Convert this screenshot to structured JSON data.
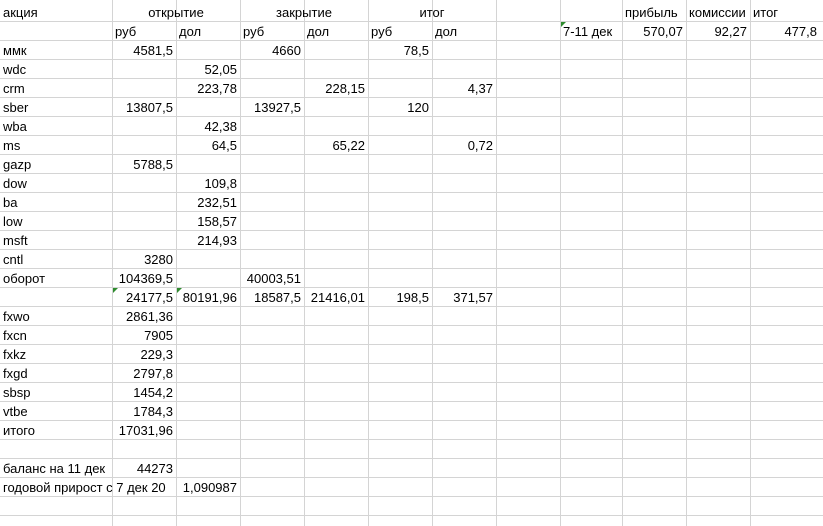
{
  "header": {
    "col_a": "акция",
    "open": "открытие",
    "close": "закрытие",
    "result": "итог",
    "profit": "прибыль",
    "fees": "комиссии",
    "total": "итог"
  },
  "subheader": {
    "open_rub": "руб",
    "open_usd": "дол",
    "close_rub": "руб",
    "close_usd": "дол",
    "result_rub": "руб",
    "result_usd": "дол",
    "period": "7-11 дек",
    "profit_value": "570,07",
    "fees_value": "92,27",
    "total_value": "477,8"
  },
  "rows": [
    {
      "name": "ммк",
      "open_rub": "4581,5",
      "open_usd": "",
      "close_rub": "4660",
      "close_usd": "",
      "res_rub": "78,5",
      "res_usd": ""
    },
    {
      "name": "wdc",
      "open_rub": "",
      "open_usd": "52,05",
      "close_rub": "",
      "close_usd": "",
      "res_rub": "",
      "res_usd": ""
    },
    {
      "name": "crm",
      "open_rub": "",
      "open_usd": "223,78",
      "close_rub": "",
      "close_usd": "228,15",
      "res_rub": "",
      "res_usd": "4,37"
    },
    {
      "name": "sber",
      "open_rub": "13807,5",
      "open_usd": "",
      "close_rub": "13927,5",
      "close_usd": "",
      "res_rub": "120",
      "res_usd": ""
    },
    {
      "name": "wba",
      "open_rub": "",
      "open_usd": "42,38",
      "close_rub": "",
      "close_usd": "",
      "res_rub": "",
      "res_usd": ""
    },
    {
      "name": "ms",
      "open_rub": "",
      "open_usd": "64,5",
      "close_rub": "",
      "close_usd": "65,22",
      "res_rub": "",
      "res_usd": "0,72"
    },
    {
      "name": "gazp",
      "open_rub": "5788,5",
      "open_usd": "",
      "close_rub": "",
      "close_usd": "",
      "res_rub": "",
      "res_usd": ""
    },
    {
      "name": "dow",
      "open_rub": "",
      "open_usd": "109,8",
      "close_rub": "",
      "close_usd": "",
      "res_rub": "",
      "res_usd": ""
    },
    {
      "name": "ba",
      "open_rub": "",
      "open_usd": "232,51",
      "close_rub": "",
      "close_usd": "",
      "res_rub": "",
      "res_usd": ""
    },
    {
      "name": "low",
      "open_rub": "",
      "open_usd": "158,57",
      "close_rub": "",
      "close_usd": "",
      "res_rub": "",
      "res_usd": ""
    },
    {
      "name": "msft",
      "open_rub": "",
      "open_usd": "214,93",
      "close_rub": "",
      "close_usd": "",
      "res_rub": "",
      "res_usd": ""
    },
    {
      "name": "cntl",
      "open_rub": "3280",
      "open_usd": "",
      "close_rub": "",
      "close_usd": "",
      "res_rub": "",
      "res_usd": ""
    },
    {
      "name": "оборот",
      "open_rub": "104369,5",
      "open_usd": "",
      "close_rub": "40003,51",
      "close_usd": "",
      "res_rub": "",
      "res_usd": ""
    },
    {
      "name": "",
      "open_rub": "24177,5",
      "open_usd": "80191,96",
      "close_rub": "18587,5",
      "close_usd": "21416,01",
      "res_rub": "198,5",
      "res_usd": "371,57"
    },
    {
      "name": "fxwo",
      "open_rub": "2861,36",
      "open_usd": "",
      "close_rub": "",
      "close_usd": "",
      "res_rub": "",
      "res_usd": ""
    },
    {
      "name": "fxcn",
      "open_rub": "7905",
      "open_usd": "",
      "close_rub": "",
      "close_usd": "",
      "res_rub": "",
      "res_usd": ""
    },
    {
      "name": "fxkz",
      "open_rub": "229,3",
      "open_usd": "",
      "close_rub": "",
      "close_usd": "",
      "res_rub": "",
      "res_usd": ""
    },
    {
      "name": "fxgd",
      "open_rub": "2797,8",
      "open_usd": "",
      "close_rub": "",
      "close_usd": "",
      "res_rub": "",
      "res_usd": ""
    },
    {
      "name": "sbsp",
      "open_rub": "1454,2",
      "open_usd": "",
      "close_rub": "",
      "close_usd": "",
      "res_rub": "",
      "res_usd": ""
    },
    {
      "name": "vtbe",
      "open_rub": "1784,3",
      "open_usd": "",
      "close_rub": "",
      "close_usd": "",
      "res_rub": "",
      "res_usd": ""
    },
    {
      "name": "итого",
      "open_rub": "17031,96",
      "open_usd": "",
      "close_rub": "",
      "close_usd": "",
      "res_rub": "",
      "res_usd": ""
    },
    {
      "name": "",
      "open_rub": "",
      "open_usd": "",
      "close_rub": "",
      "close_usd": "",
      "res_rub": "",
      "res_usd": ""
    },
    {
      "name": "баланс на 11 дек",
      "open_rub": "44273",
      "open_usd": "",
      "close_rub": "",
      "close_usd": "",
      "res_rub": "",
      "res_usd": ""
    },
    {
      "name": "годовой прирост с 7 дек 20",
      "open_rub": "",
      "open_usd": "1,090987",
      "close_rub": "",
      "close_usd": "",
      "res_rub": "",
      "res_usd": ""
    }
  ],
  "colors": {
    "gridline": "#d4d4d4",
    "error_triangle": "#2e8b2e"
  }
}
